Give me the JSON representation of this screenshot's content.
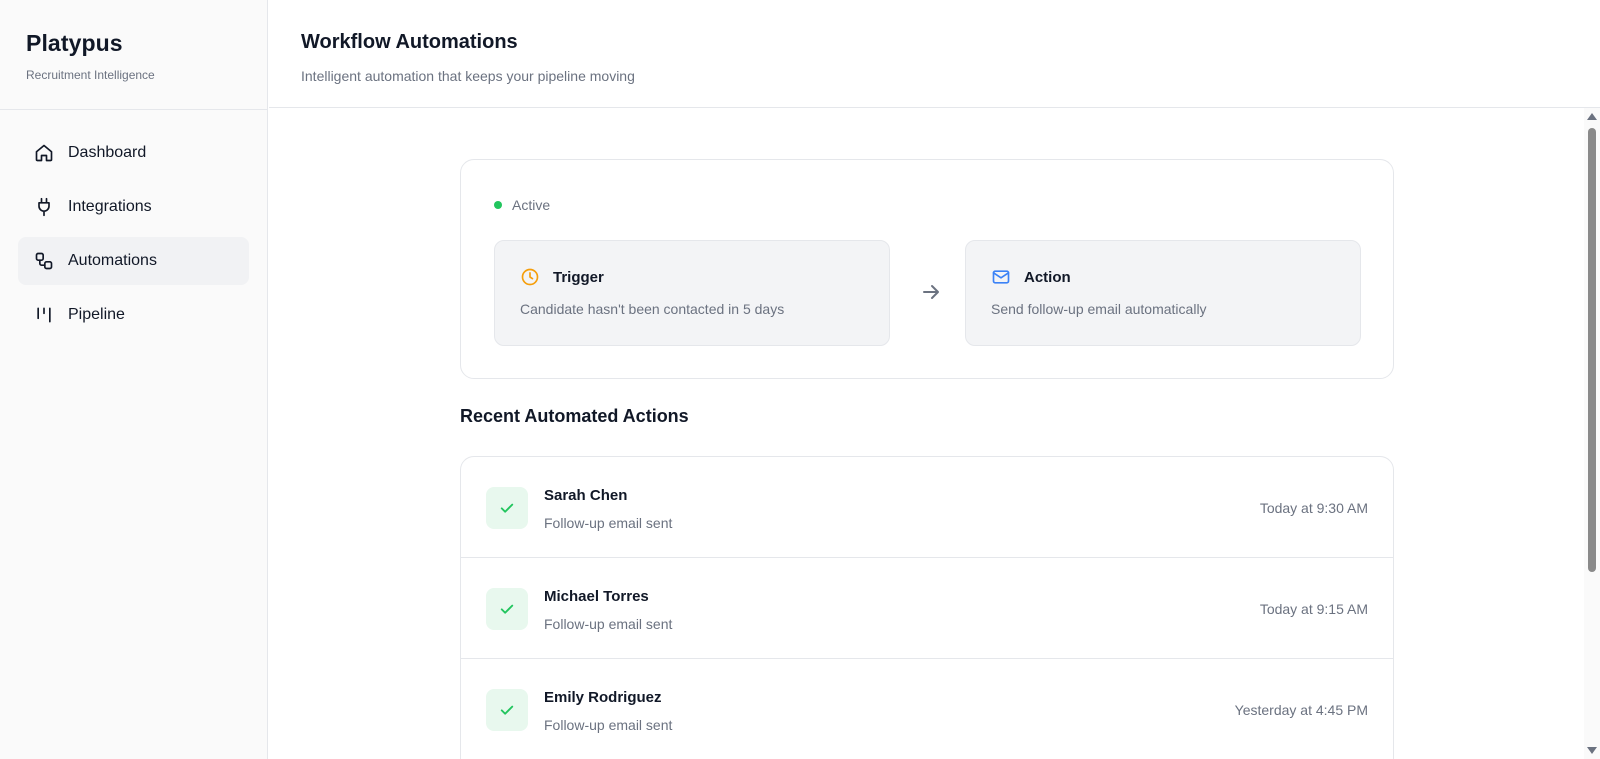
{
  "app": {
    "name": "Platypus",
    "tagline": "Recruitment Intelligence"
  },
  "sidebar": {
    "items": [
      {
        "label": "Dashboard",
        "icon": "home-icon",
        "active": false
      },
      {
        "label": "Integrations",
        "icon": "plug-icon",
        "active": false
      },
      {
        "label": "Automations",
        "icon": "workflow-icon",
        "active": true
      },
      {
        "label": "Pipeline",
        "icon": "kanban-icon",
        "active": false
      }
    ]
  },
  "header": {
    "title": "Workflow Automations",
    "subtitle": "Intelligent automation that keeps your pipeline moving"
  },
  "workflow": {
    "status": "Active",
    "trigger": {
      "icon": "clock-icon",
      "title": "Trigger",
      "description": "Candidate hasn't been contacted in 5 days"
    },
    "action": {
      "icon": "mail-icon",
      "title": "Action",
      "description": "Send follow-up email automatically"
    }
  },
  "recent": {
    "title": "Recent Automated Actions",
    "rows": [
      {
        "name": "Sarah Chen",
        "detail": "Follow-up email sent",
        "time": "Today at 9:30 AM"
      },
      {
        "name": "Michael Torres",
        "detail": "Follow-up email sent",
        "time": "Today at 9:15 AM"
      },
      {
        "name": "Emily Rodriguez",
        "detail": "Follow-up email sent",
        "time": "Yesterday at 4:45 PM"
      }
    ]
  },
  "colors": {
    "accent_active": "#22c55e",
    "trigger_icon": "#f59e0b",
    "action_icon": "#3b82f6",
    "check_icon": "#22c55e"
  }
}
